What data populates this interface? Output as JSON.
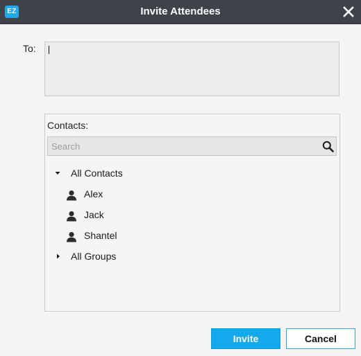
{
  "window": {
    "title": "Invite Attendees",
    "app_logo_text": "EZ",
    "close_icon": "close-icon"
  },
  "to": {
    "label": "To:",
    "value": ""
  },
  "contacts": {
    "label": "Contacts:",
    "search_placeholder": "Search",
    "search_value": "",
    "search_icon": "search-icon",
    "tree": [
      {
        "label": "All Contacts",
        "expanded": true,
        "children": [
          {
            "label": "Alex",
            "icon": "person-icon"
          },
          {
            "label": "Jack",
            "icon": "person-icon"
          },
          {
            "label": "Shantel",
            "icon": "person-icon"
          }
        ]
      },
      {
        "label": "All Groups",
        "expanded": false,
        "children": []
      }
    ]
  },
  "buttons": {
    "invite_label": "Invite",
    "cancel_label": "Cancel"
  },
  "colors": {
    "titlebar": "#3f4349",
    "accent": "#13a9ec",
    "logo": "#22a7e8"
  }
}
